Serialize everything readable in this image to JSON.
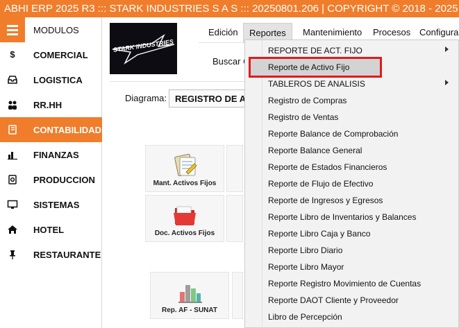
{
  "window": {
    "title": "ABHI ERP 2025 R3 ::: STARK INDUSTRIES S A S ::: 20250801.206 | COPYRIGHT ©  2018 - 2025"
  },
  "sidebar": {
    "header_label": "MODULOS",
    "items": [
      {
        "label": "COMERCIAL",
        "icon": "dollar-icon",
        "active": false
      },
      {
        "label": "LOGISTICA",
        "icon": "inbox-icon",
        "active": false
      },
      {
        "label": "RR.HH",
        "icon": "users-icon",
        "active": false
      },
      {
        "label": "CONTABILIDAD",
        "icon": "book-icon",
        "active": true
      },
      {
        "label": "FINANZAS",
        "icon": "bar-chart-icon",
        "active": false
      },
      {
        "label": "PRODUCCION",
        "icon": "gear-icon",
        "active": false
      },
      {
        "label": "SISTEMAS",
        "icon": "monitor-icon",
        "active": false
      },
      {
        "label": "HOTEL",
        "icon": "home-icon",
        "active": false
      },
      {
        "label": "RESTAURANTE",
        "icon": "pin-icon",
        "active": false
      }
    ]
  },
  "logo": {
    "text": "STARK INDUSTRIES"
  },
  "menubar": {
    "items": [
      "Edición",
      "Reportes",
      "Mantenimiento",
      "Procesos",
      "Configuració"
    ]
  },
  "search": {
    "label": "Buscar C"
  },
  "diagram": {
    "label": "Diagrama:",
    "value": "REGISTRO DE ACT"
  },
  "tiles": [
    {
      "label": "Mant. Activos Fijos",
      "icon": "clipboard-icon"
    },
    {
      "label": "Doc. Activos Fijos",
      "icon": "folder-icon"
    },
    {
      "label": "Rep. AF - SUNAT",
      "icon": "bar-chart-icon"
    }
  ],
  "dropdown": {
    "items": [
      {
        "label": "REPORTE DE ACT. FIJO",
        "submenu": true
      },
      {
        "label": "Reporte de Activo Fijo",
        "submenu": false,
        "highlighted": true
      },
      {
        "label": "TABLEROS DE ANALISIS",
        "submenu": true
      },
      {
        "label": "Registro de Compras",
        "submenu": false
      },
      {
        "label": "Registro de Ventas",
        "submenu": false
      },
      {
        "label": "Reporte Balance de Comprobación",
        "submenu": false
      },
      {
        "label": "Reporte Balance General",
        "submenu": false
      },
      {
        "label": "Reporte de Estados Financieros",
        "submenu": false
      },
      {
        "label": "Reporte de Flujo de Efectivo",
        "submenu": false
      },
      {
        "label": "Reporte de Ingresos y Egresos",
        "submenu": false
      },
      {
        "label": "Reporte Libro de Inventarios y Balances",
        "submenu": false
      },
      {
        "label": "Reporte Libro Caja y Banco",
        "submenu": false
      },
      {
        "label": "Reporte Libro Diario",
        "submenu": false
      },
      {
        "label": "Reporte Libro Mayor",
        "submenu": false
      },
      {
        "label": "Reporte Registro Movimiento de Cuentas",
        "submenu": false
      },
      {
        "label": "Reporte DAOT Cliente y Proveedor",
        "submenu": false
      },
      {
        "label": "Libro de Percepción",
        "submenu": false
      }
    ]
  },
  "colors": {
    "accent": "#f07d2b",
    "highlight_border": "#e01b1b"
  }
}
